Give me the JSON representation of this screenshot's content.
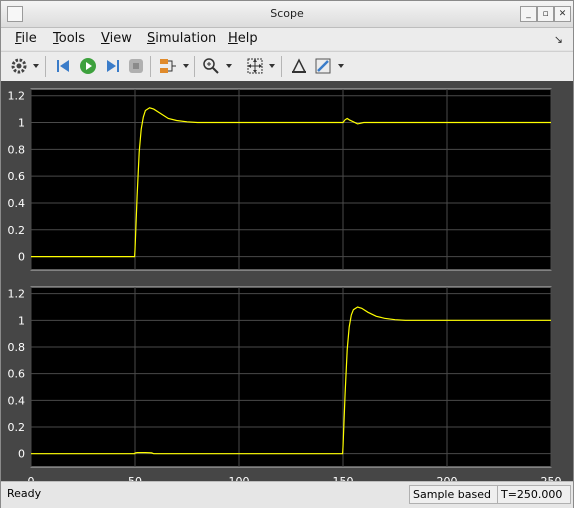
{
  "window": {
    "title": "Scope"
  },
  "menu": {
    "items": [
      {
        "label": "File",
        "mnemonic": "F",
        "rest": "ile"
      },
      {
        "label": "Tools",
        "mnemonic": "T",
        "rest": "ools"
      },
      {
        "label": "View",
        "mnemonic": "V",
        "rest": "iew"
      },
      {
        "label": "Simulation",
        "mnemonic": "S",
        "rest": "imulation"
      },
      {
        "label": "Help",
        "mnemonic": "H",
        "rest": "elp"
      }
    ]
  },
  "toolbar": {
    "icons": [
      "gear-icon",
      "step-back-icon",
      "run-icon",
      "step-forward-icon",
      "stop-icon",
      "signal-select-icon",
      "zoom-in-icon",
      "autoscale-icon",
      "highlight-block-icon",
      "style-icon"
    ]
  },
  "status": {
    "left": "Ready",
    "mode": "Sample based",
    "time": "T=250.000"
  },
  "colors": {
    "plot_bg": "#000000",
    "trace": "#ffff00",
    "figure_bg": "#464646",
    "tick_label": "#ffffff"
  },
  "chart_data": [
    {
      "type": "line",
      "title": "",
      "xlabel": "",
      "ylabel": "",
      "xlim": [
        0,
        250
      ],
      "ylim": [
        -0.1,
        1.25
      ],
      "yticks": [
        0,
        0.2,
        0.4,
        0.6,
        0.8,
        1,
        1.2
      ],
      "yticklabels": [
        "0",
        "0.2",
        "0.4",
        "0.6",
        "0.8",
        "1",
        "1.2"
      ],
      "xticks": [
        0,
        50,
        100,
        150,
        200,
        250
      ],
      "xticklabels": [],
      "grid": true,
      "series": [
        {
          "color": "#ffff00",
          "x": [
            0,
            49.8,
            50,
            51,
            52,
            53,
            54,
            55,
            57,
            59,
            62,
            66,
            70,
            75,
            80,
            85,
            100,
            149,
            150,
            151,
            152,
            153,
            155,
            157,
            160,
            250
          ],
          "y": [
            0,
            0,
            0.05,
            0.45,
            0.78,
            0.95,
            1.04,
            1.09,
            1.11,
            1.1,
            1.07,
            1.03,
            1.015,
            1.005,
            1.0,
            1.0,
            1.0,
            1.0,
            1.0,
            1.02,
            1.03,
            1.02,
            1.005,
            0.99,
            1.0,
            1.0
          ]
        }
      ]
    },
    {
      "type": "line",
      "title": "",
      "xlabel": "",
      "ylabel": "",
      "xlim": [
        0,
        250
      ],
      "ylim": [
        -0.1,
        1.25
      ],
      "yticks": [
        0,
        0.2,
        0.4,
        0.6,
        0.8,
        1,
        1.2
      ],
      "yticklabels": [
        "0",
        "0.2",
        "0.4",
        "0.6",
        "0.8",
        "1",
        "1.2"
      ],
      "xticks": [
        0,
        50,
        100,
        150,
        200,
        250
      ],
      "xticklabels": [
        "0",
        "50",
        "100",
        "150",
        "200",
        "250"
      ],
      "grid": true,
      "series": [
        {
          "color": "#ffff00",
          "x": [
            0,
            49.9,
            50,
            51,
            55,
            58,
            59,
            149.8,
            150,
            151,
            152,
            153,
            154,
            155,
            157,
            159,
            162,
            166,
            170,
            175,
            180,
            250
          ],
          "y": [
            0,
            0,
            0.005,
            0.008,
            0.008,
            0.006,
            0,
            0,
            0.05,
            0.45,
            0.78,
            0.95,
            1.04,
            1.08,
            1.1,
            1.09,
            1.06,
            1.03,
            1.015,
            1.005,
            1.0,
            1.0
          ]
        }
      ]
    }
  ]
}
